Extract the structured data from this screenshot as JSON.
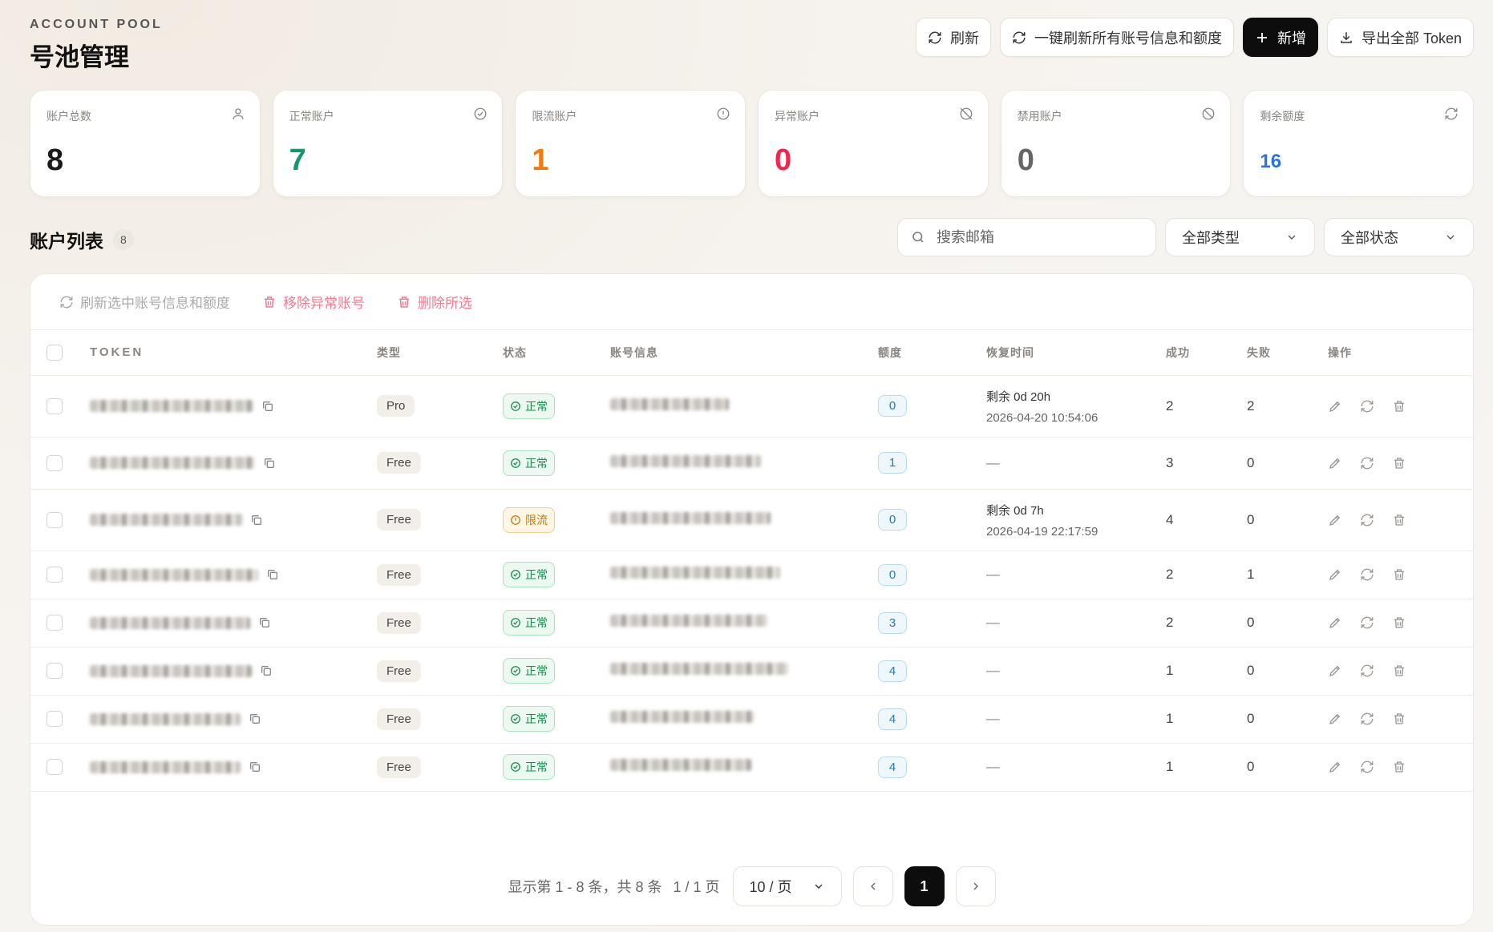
{
  "header": {
    "eyebrow": "ACCOUNT POOL",
    "title": "号池管理"
  },
  "toolbar": {
    "refresh_label": "刷新",
    "refresh_all_label": "一键刷新所有账号信息和额度",
    "add_label": "新增",
    "export_label": "导出全部 Token"
  },
  "stats": [
    {
      "label": "账户总数",
      "value": "8",
      "icon": "user-icon",
      "color": "#1a1a1a"
    },
    {
      "label": "正常账户",
      "value": "7",
      "icon": "check-circle-icon",
      "color": "#12986b"
    },
    {
      "label": "限流账户",
      "value": "1",
      "icon": "alert-circle-icon",
      "color": "#f07a12"
    },
    {
      "label": "异常账户",
      "value": "0",
      "icon": "ban-slash-icon",
      "color": "#f0264e"
    },
    {
      "label": "禁用账户",
      "value": "0",
      "icon": "ban-icon",
      "color": "#666666"
    },
    {
      "label": "剩余额度",
      "value": "16",
      "icon": "refresh-icon",
      "color": "#2e74d8"
    }
  ],
  "list": {
    "title": "账户列表",
    "count": "8",
    "search_placeholder": "搜索邮箱",
    "type_filter": "全部类型",
    "status_filter": "全部状态"
  },
  "bulk": {
    "refresh_selected": "刷新选中账号信息和额度",
    "remove_abnormal": "移除异常账号",
    "delete_selected": "删除所选"
  },
  "columns": {
    "token": "TOKEN",
    "type": "类型",
    "status": "状态",
    "account": "账号信息",
    "quota": "额度",
    "recover": "恢复时间",
    "success": "成功",
    "fail": "失败",
    "actions": "操作"
  },
  "rows": [
    {
      "type": "Pro",
      "status": "正常",
      "status_kind": "ok",
      "quota": "0",
      "recover_main": "剩余 0d 20h",
      "recover_sub": "2026-04-20 10:54:06",
      "success": "2",
      "fail": "2"
    },
    {
      "type": "Free",
      "status": "正常",
      "status_kind": "ok",
      "quota": "1",
      "recover_main": "—",
      "recover_sub": "",
      "success": "3",
      "fail": "0"
    },
    {
      "type": "Free",
      "status": "限流",
      "status_kind": "limit",
      "quota": "0",
      "recover_main": "剩余 0d 7h",
      "recover_sub": "2026-04-19 22:17:59",
      "success": "4",
      "fail": "0"
    },
    {
      "type": "Free",
      "status": "正常",
      "status_kind": "ok",
      "quota": "0",
      "recover_main": "—",
      "recover_sub": "",
      "success": "2",
      "fail": "1"
    },
    {
      "type": "Free",
      "status": "正常",
      "status_kind": "ok",
      "quota": "3",
      "recover_main": "—",
      "recover_sub": "",
      "success": "2",
      "fail": "0"
    },
    {
      "type": "Free",
      "status": "正常",
      "status_kind": "ok",
      "quota": "4",
      "recover_main": "—",
      "recover_sub": "",
      "success": "1",
      "fail": "0"
    },
    {
      "type": "Free",
      "status": "正常",
      "status_kind": "ok",
      "quota": "4",
      "recover_main": "—",
      "recover_sub": "",
      "success": "1",
      "fail": "0"
    },
    {
      "type": "Free",
      "status": "正常",
      "status_kind": "ok",
      "quota": "4",
      "recover_main": "—",
      "recover_sub": "",
      "success": "1",
      "fail": "0"
    }
  ],
  "pagination": {
    "info": "显示第 1 - 8 条，共 8 条",
    "pages": "1 / 1 页",
    "page_size": "10 / 页",
    "current": "1"
  }
}
